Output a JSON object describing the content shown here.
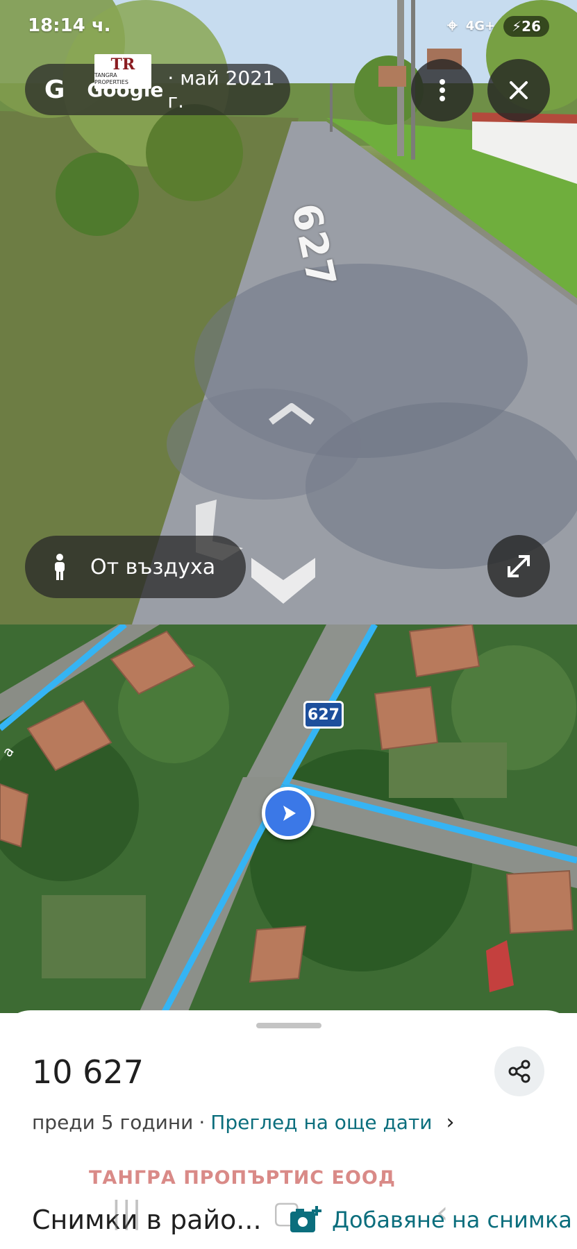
{
  "status_bar": {
    "time": "18:14 ч.",
    "network": "4G+",
    "battery": "26"
  },
  "street_view": {
    "google_label": "Google",
    "date_label": "· май 2021 г.",
    "logo_mark": "TR",
    "logo_sub": "TANGRA PROPERTIES",
    "road_number": "627",
    "aerial_button_label": "От въздуха",
    "icons": [
      "google-g-icon",
      "more-vert-icon",
      "close-icon",
      "pegman-icon",
      "expand-icon",
      "move-forward-arrow-icon",
      "move-back-arrow-icon"
    ]
  },
  "map": {
    "route_badge": "627",
    "partial_street_label": "а"
  },
  "sheet": {
    "title": "10 627",
    "age": "преди 5 години",
    "separator": "·",
    "more_dates_link": "Преглед на още дати",
    "watermark": "ТАНГРА ПРОПЪРТИС  ЕООД",
    "photos_section_title": "Снимки в райо...",
    "add_photo_label": "Добавяне на снимка"
  },
  "colors": {
    "accent_link": "#0b6e7d",
    "route_line": "#35b4f4",
    "route_badge": "#1d4f9c",
    "location_dot": "#3b78e7",
    "watermark": "#d98a87"
  }
}
